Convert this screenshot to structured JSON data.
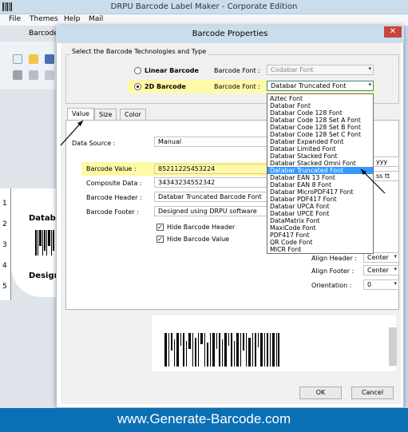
{
  "outer": {
    "title": "DRPU Barcode Label Maker - Corporate Edition",
    "menu": [
      "File",
      "Themes",
      "Help",
      "Mail"
    ],
    "tab_label": "Barcode",
    "ruler_numbers": [
      "1",
      "2",
      "3",
      "4",
      "5"
    ],
    "preview_lines": [
      "Databa",
      "Design"
    ]
  },
  "dialog": {
    "title": "Barcode Properties",
    "close": "✕",
    "group_label": "Select the Barcode Technologies and Type",
    "linear_label": "Linear Barcode",
    "linear_font_label": "Barcode Font :",
    "linear_font_value": "Codabar Font",
    "twod_label": "2D Barcode",
    "twod_font_label": "Barcode Font :",
    "twod_font_value": "Databar Truncated Font",
    "tabs": [
      "Value",
      "Size",
      "Color"
    ],
    "data_source_label": "Data Source :",
    "data_source_value": "Manual",
    "barcode_value_label": "Barcode Value :",
    "barcode_value": "85211225453224",
    "composite_label": "Composite Data :",
    "composite_value": "34343234552342",
    "header_label": "Barcode Header :",
    "header_value": "Databar Truncated Barcode Font",
    "footer_label": "Barcode Footer :",
    "footer_value": "Designed using DRPU software",
    "hide_header_label": "Hide Barcode Header",
    "hide_value_label": "Hide Barcode Value",
    "right_dd1": "yyy",
    "right_dd2": "ss tt",
    "align_header_label": "Align Header :",
    "align_header_value": "Center",
    "align_footer_label": "Align Footer :",
    "align_footer_value": "Center",
    "orientation_label": "Orientation :",
    "orientation_value": "0",
    "ok": "OK",
    "cancel": "Cancel"
  },
  "font_list": {
    "selected": "Databar Truncated Font",
    "items": [
      "Aztec Font",
      "Databar Font",
      "Databar Code 128 Font",
      "Databar Code 128 Set A Font",
      "Databar Code 128 Set B Font",
      "Databar Code 128 Set C Font",
      "Databar Expanded Font",
      "Databar Limited Font",
      "Databar Stacked Font",
      "Databar Stacked Omni Font",
      "Databar Truncated Font",
      "Databar EAN 13 Font",
      "Databar EAN 8 Font",
      "Databar MicroPDF417 Font",
      "Databar PDF417 Font",
      "Databar UPCA Font",
      "Databar UPCE Font",
      "DataMatrix Font",
      "MaxiCode Font",
      "PDF417 Font",
      "QR Code Font",
      "MICR Font"
    ]
  },
  "footer": {
    "text": "www.Generate-Barcode.com"
  },
  "colors": {
    "footer_bg": "#0b6fb6",
    "highlight": "#fff9a8",
    "selection": "#3399ff",
    "title_bar": "#c9ddec"
  }
}
